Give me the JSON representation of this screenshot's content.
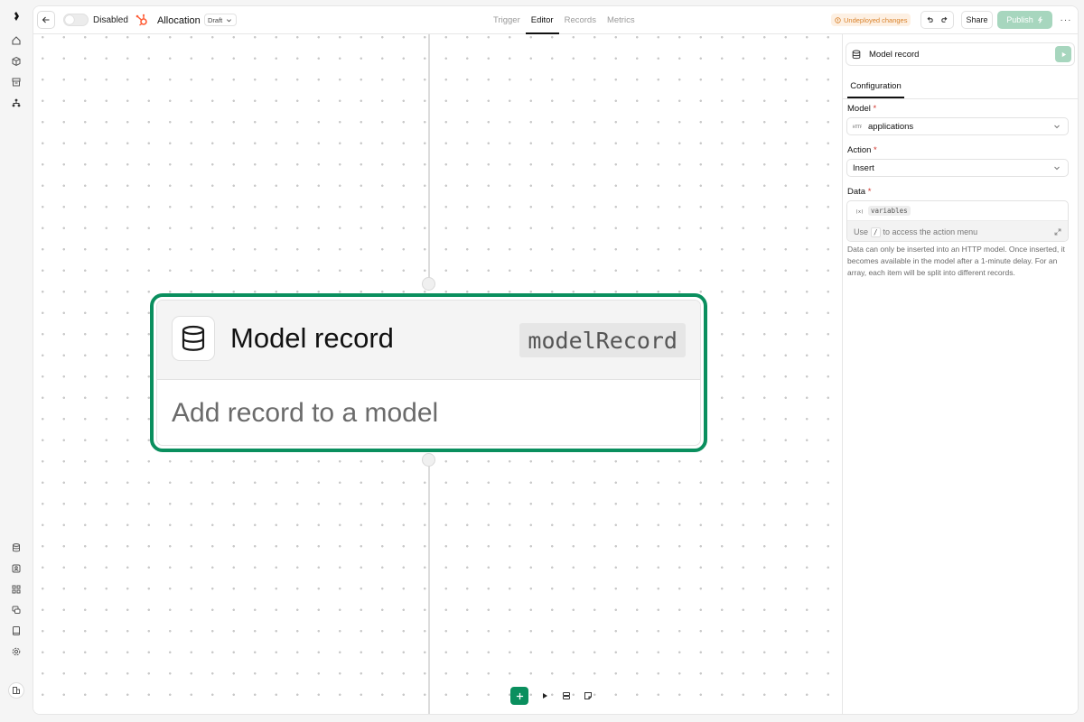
{
  "header": {
    "toggle_label": "Disabled",
    "app_title": "Allocation",
    "draft_label": "Draft",
    "tabs": [
      {
        "label": "Trigger",
        "active": false
      },
      {
        "label": "Editor",
        "active": true
      },
      {
        "label": "Records",
        "active": false
      },
      {
        "label": "Metrics",
        "active": false
      }
    ],
    "undeployed_label": "Undeployed changes",
    "share_label": "Share",
    "publish_label": "Publish",
    "more_label": "···"
  },
  "node": {
    "title": "Model record",
    "code": "modelRecord",
    "description": "Add record to a model",
    "accent": "#0a8f5e"
  },
  "panel": {
    "title": "Model record",
    "config_tab": "Configuration",
    "model_label": "Model",
    "model_value": "applications",
    "action_label": "Action",
    "action_value": "Insert",
    "data_label": "Data",
    "required_mark": "*",
    "variables_chip": "variables",
    "hint_before": "Use",
    "hint_key": "/",
    "hint_after": "to access the action menu",
    "help_text": "Data can only be inserted into an HTTP model. Once inserted, it becomes available in the model after a 1-minute delay. For an array, each item will be split into different records."
  },
  "icons": {
    "rail_top": [
      "logo-icon",
      "home-icon",
      "cube-icon",
      "archive-icon",
      "workflow-icon"
    ],
    "rail_bottom": [
      "database-icon",
      "contact-icon",
      "apps-icon",
      "chat-icon",
      "book-icon",
      "settings-icon",
      "org-icon"
    ]
  },
  "colors": {
    "brand_green": "#0a8f5e",
    "publish_disabled": "#a7d6be",
    "warning": "#d9822b",
    "hubspot": "#ff5c35"
  }
}
